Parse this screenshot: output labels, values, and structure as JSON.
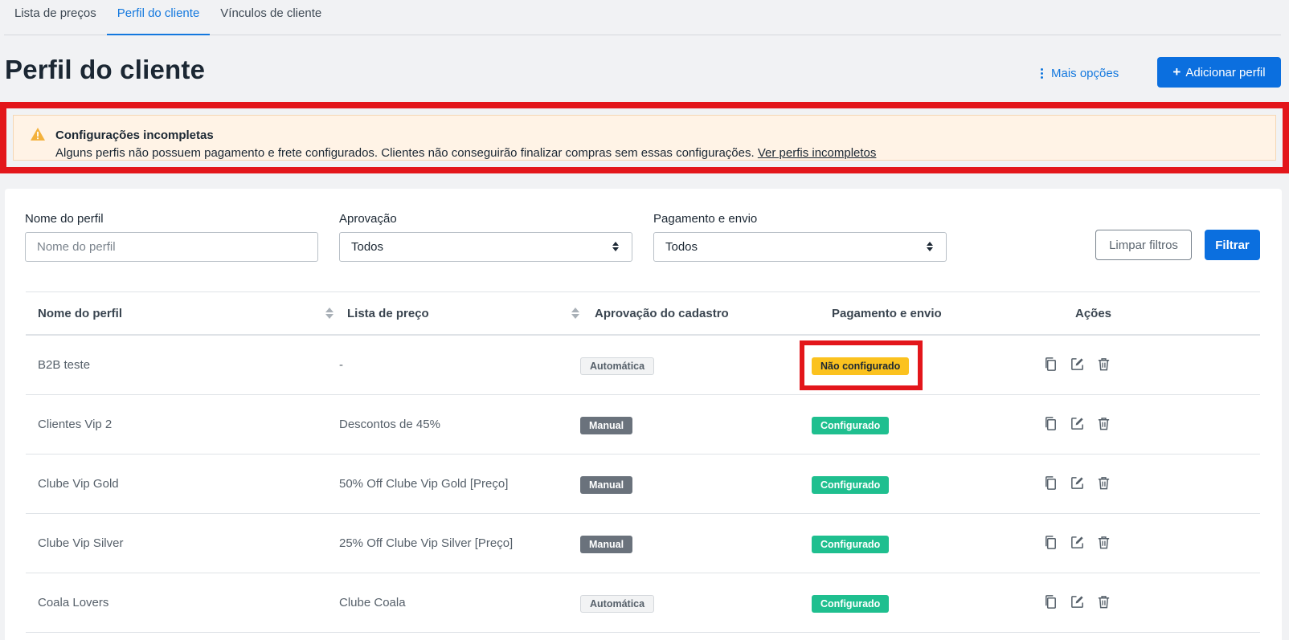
{
  "tabs": [
    {
      "label": "Lista de preços"
    },
    {
      "label": "Perfil do cliente"
    },
    {
      "label": "Vínculos de cliente"
    }
  ],
  "header": {
    "title": "Perfil do cliente",
    "more_options": "Mais opções",
    "add_button": "Adicionar perfil"
  },
  "alert": {
    "title": "Configurações incompletas",
    "message": "Alguns perfis não possuem pagamento e frete configurados. Clientes não conseguirão finalizar compras sem essas configurações.",
    "link": "Ver perfis incompletos"
  },
  "filters": {
    "name_label": "Nome do perfil",
    "name_placeholder": "Nome do perfil",
    "approval_label": "Aprovação",
    "approval_value": "Todos",
    "payment_label": "Pagamento e envio",
    "payment_value": "Todos",
    "clear_button": "Limpar filtros",
    "filter_button": "Filtrar"
  },
  "table": {
    "columns": [
      "Nome do perfil",
      "Lista de preço",
      "Aprovação do cadastro",
      "Pagamento e envio",
      "Ações"
    ],
    "rows": [
      {
        "name": "B2B teste",
        "price_list": "-",
        "approval": "Automática",
        "payment": "Não configurado"
      },
      {
        "name": "Clientes Vip 2",
        "price_list": "Descontos de 45%",
        "approval": "Manual",
        "payment": "Configurado"
      },
      {
        "name": "Clube Vip Gold",
        "price_list": "50% Off Clube Vip Gold [Preço]",
        "approval": "Manual",
        "payment": "Configurado"
      },
      {
        "name": "Clube Vip Silver",
        "price_list": "25% Off Clube Vip Silver [Preço]",
        "approval": "Manual",
        "payment": "Configurado"
      },
      {
        "name": "Coala Lovers",
        "price_list": "Clube Coala",
        "approval": "Automática",
        "payment": "Configurado"
      }
    ]
  },
  "colors": {
    "primary": "#0b6fdf",
    "active_tab": "#1378de",
    "warning_badge": "#fbc21f",
    "success_badge": "#1fbf8f",
    "manual_badge": "#6a727c",
    "alert_bg": "#fff3e6",
    "highlight_border": "#e3161b"
  },
  "icons": [
    "warning-icon",
    "more-options-icon",
    "plus-icon",
    "select-arrows-icon",
    "sort-icon",
    "copy-icon",
    "edit-icon",
    "delete-icon"
  ]
}
